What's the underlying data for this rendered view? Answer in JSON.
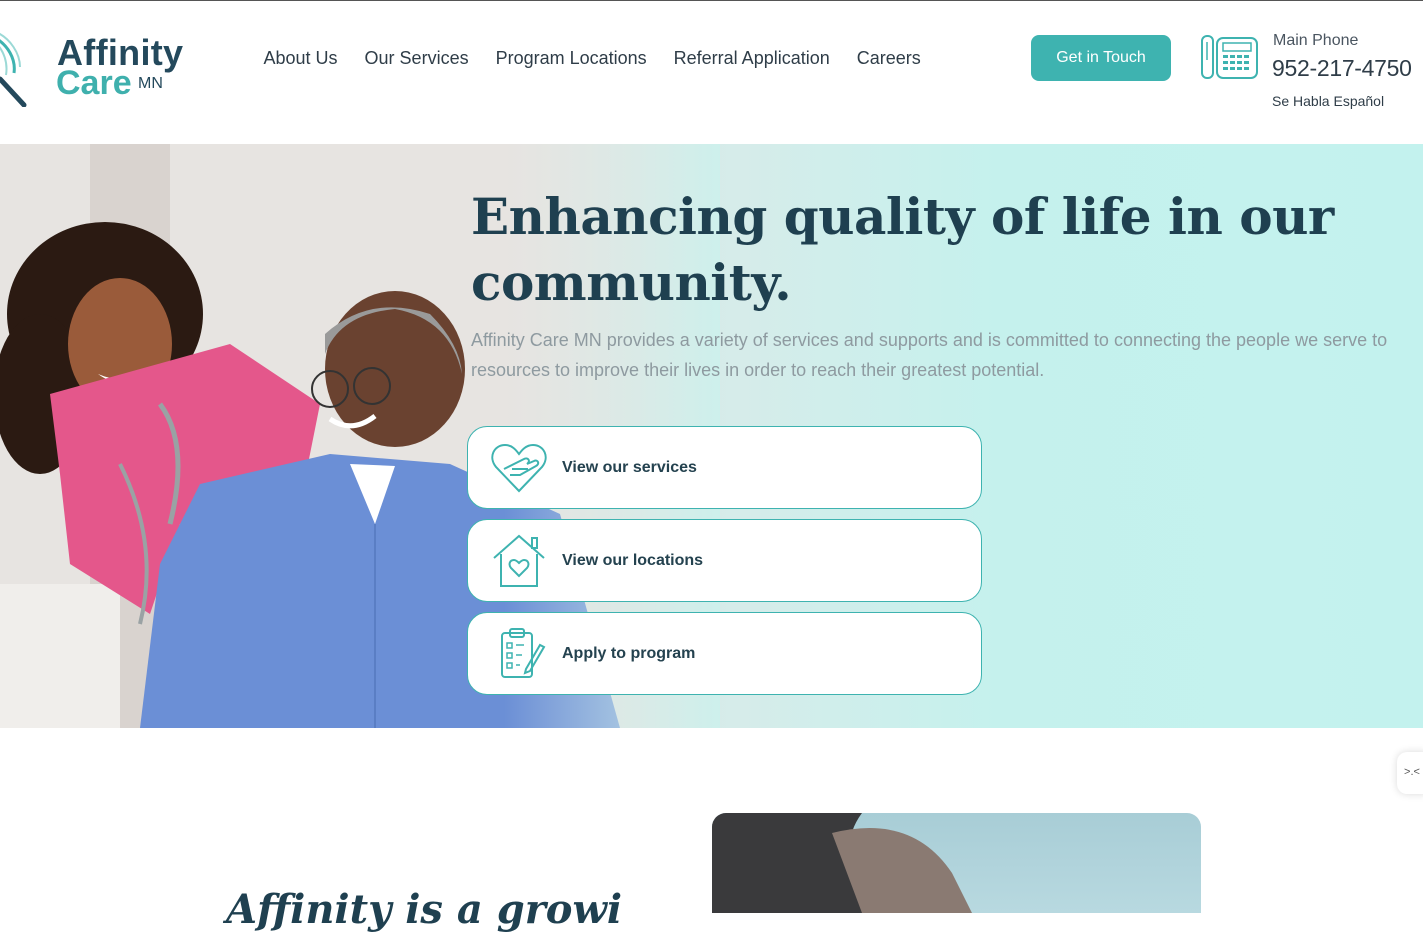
{
  "brand": {
    "word1": "Affinity",
    "word2": "Care",
    "suffix": "MN"
  },
  "nav": [
    "About Us",
    "Our Services",
    "Program Locations",
    "Referral Application",
    "Careers"
  ],
  "cta_label": "Get in Touch",
  "phone": {
    "label": "Main Phone",
    "number": "952-217-4750",
    "note": "Se Habla Español"
  },
  "hero": {
    "title": "Enhancing quality of life in our community.",
    "text": "Affinity Care MN provides a variety of services and supports and is committed to connecting the people we serve to resources to improve their lives in order to reach their greatest potential.",
    "cards": [
      {
        "label": "View our services",
        "icon": "heart-hand-icon"
      },
      {
        "label": "View our locations",
        "icon": "house-heart-icon"
      },
      {
        "label": "Apply to program",
        "icon": "clipboard-checklist-icon"
      }
    ]
  },
  "section": {
    "title": "Affinity is a growi"
  },
  "side_tab": {
    "text": ">.<"
  },
  "colors": {
    "teal": "#3eb3b0",
    "navy": "#1f4050",
    "hero_bg": "#c3f2ee"
  }
}
